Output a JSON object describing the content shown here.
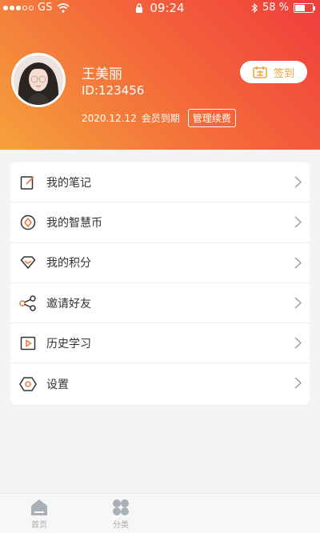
{
  "status_bar": {
    "carrier": "GS",
    "time": "09:24",
    "battery": "58 %"
  },
  "profile": {
    "name": "王美丽",
    "id": "ID:123456",
    "expire_date": "2020.12.12",
    "expire_text": "会员到期",
    "renew_label": "管理续费",
    "checkin_label": "签到"
  },
  "menu": [
    {
      "label": "我的笔记",
      "icon": "note-edit-icon"
    },
    {
      "label": "我的智慧币",
      "icon": "coin-icon"
    },
    {
      "label": "我的积分",
      "icon": "diamond-icon"
    },
    {
      "label": "邀请好友",
      "icon": "share-icon"
    },
    {
      "label": "历史学习",
      "icon": "play-history-icon"
    },
    {
      "label": "设置",
      "icon": "settings-icon"
    }
  ],
  "tabbar": [
    {
      "label": "首页",
      "icon": "home-icon"
    },
    {
      "label": "分类",
      "icon": "category-icon"
    }
  ],
  "colors": {
    "header_start": "#f5a13c",
    "header_end": "#f03c3c",
    "icon_accent": "#f07a3a"
  }
}
